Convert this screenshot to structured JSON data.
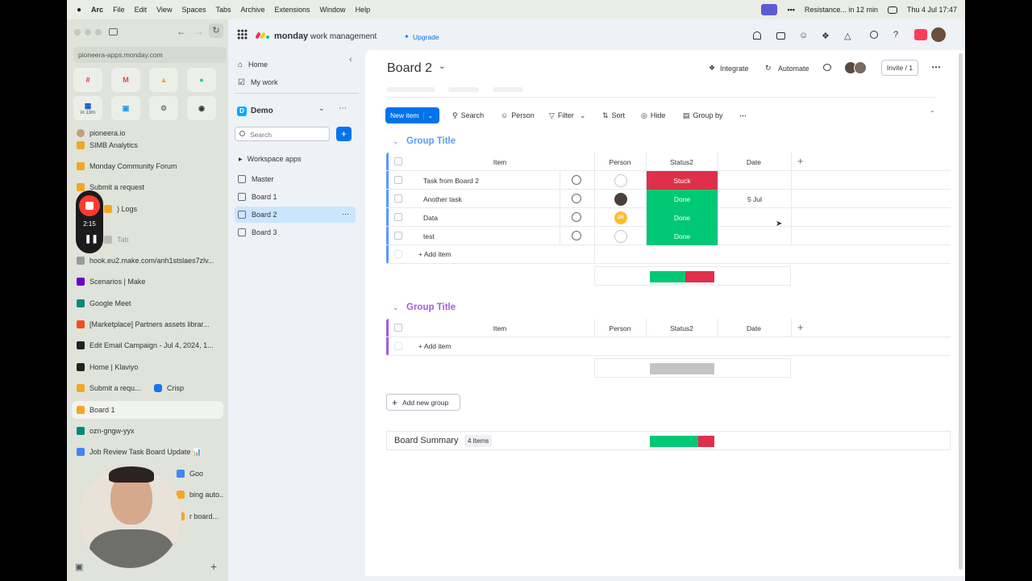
{
  "menubar": {
    "items": [
      "Arc",
      "File",
      "Edit",
      "View",
      "Spaces",
      "Tabs",
      "Archive",
      "Extensions",
      "Window",
      "Help"
    ],
    "status": "Resistance... in 12 min",
    "datetime": "Thu 4 Jul  17:47"
  },
  "arc": {
    "url": "pioneera-apps.monday.com",
    "fav_badge": "in 13m",
    "section": "pioneera.io",
    "tabs": [
      {
        "label": "SIMB Analytics",
        "color": "#f5a623"
      },
      {
        "label": "Monday Community Forum",
        "color": "#f5a623"
      },
      {
        "label": "Submit a request",
        "color": "#f5a623"
      },
      {
        "label": ") Logs",
        "color": "#f5a623"
      },
      {
        "label": "Tab",
        "color": "#b8bcb4"
      },
      {
        "label": "hook.eu2.make.com/anh1stslaes7zlv...",
        "color": "#999999"
      },
      {
        "label": "Scenarios | Make",
        "color": "#6d00cc"
      },
      {
        "label": "Google Meet",
        "color": "#00897b"
      },
      {
        "label": "[Marketplace] Partners assets librar...",
        "color": "#f24e1e"
      },
      {
        "label": "Edit Email Campaign - Jul 4, 2024, 1...",
        "color": "#222222"
      },
      {
        "label": "Home | Klaviyo",
        "color": "#222222"
      },
      {
        "label": "Submit a requ...",
        "color": "#f5a623"
      },
      {
        "label": "Board 1",
        "color": "#f5a623"
      },
      {
        "label": "ozn-gngw-yyx",
        "color": "#00897b"
      },
      {
        "label": "Job Review Task Board Update 📊",
        "color": "#4285f4"
      },
      {
        "label": "Goo",
        "color": "#4285f4"
      },
      {
        "label": "bing auto...",
        "color": "#f5a623"
      },
      {
        "label": "r board...",
        "color": "#f5a623"
      }
    ],
    "crisp_label": "Crisp",
    "recorder_time": "2:15"
  },
  "topbar": {
    "brand": "monday",
    "brand_suffix": "work management",
    "upgrade": "Upgrade"
  },
  "leftnav": {
    "home": "Home",
    "mywork": "My work",
    "workspace": "Demo",
    "workspace_initial": "D",
    "search_placeholder": "Search",
    "workspace_apps": "Workspace apps",
    "boards": [
      "Master",
      "Board 1",
      "Board 2",
      "Board 3"
    ]
  },
  "board": {
    "title": "Board 2",
    "integrate": "Integrate",
    "automate": "Automate",
    "invite": "Invite / 1",
    "new_item": "New item",
    "toolbar": [
      "Search",
      "Person",
      "Filter",
      "Sort",
      "Hide",
      "Group by"
    ],
    "columns": {
      "item": "Item",
      "person": "Person",
      "status": "Status2",
      "date": "Date"
    },
    "group1": {
      "title": "Group Title",
      "color": "#579bfc",
      "rows": [
        {
          "name": "Task from Board 2",
          "person": "empty",
          "status": "Stuck",
          "status_color": "#df2f4a",
          "date": ""
        },
        {
          "name": "Another task",
          "person": "photo",
          "status": "Done",
          "status_color": "#00c875",
          "date": "5 Jul"
        },
        {
          "name": "Data",
          "person": "JR",
          "status": "Done",
          "status_color": "#00c875",
          "date": ""
        },
        {
          "name": "test",
          "person": "empty",
          "status": "Done",
          "status_color": "#00c875",
          "date": ""
        }
      ],
      "add_item": "+ Add item",
      "summary_split": [
        0.55,
        0.45
      ]
    },
    "group2": {
      "title": "Group Title",
      "color": "#a25ddc",
      "add_item": "+ Add item"
    },
    "add_group": "Add new group",
    "summary": {
      "label": "Board Summary",
      "count": "4 Items",
      "split": [
        0.75,
        0.25
      ]
    },
    "colors": {
      "done": "#00c875",
      "stuck": "#df2f4a",
      "primary": "#0073ea",
      "empty": "#c4c4c4"
    }
  }
}
